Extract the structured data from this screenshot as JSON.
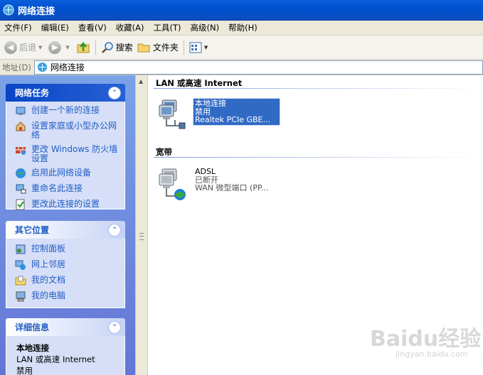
{
  "window": {
    "title": "网络连接"
  },
  "menu": [
    {
      "label": "文件(F)"
    },
    {
      "label": "编辑(E)"
    },
    {
      "label": "查看(V)"
    },
    {
      "label": "收藏(A)"
    },
    {
      "label": "工具(T)"
    },
    {
      "label": "高级(N)"
    },
    {
      "label": "帮助(H)"
    }
  ],
  "toolbar": {
    "back": "后退",
    "search": "搜索",
    "folders": "文件夹"
  },
  "address": {
    "label": "地址(D)",
    "value": "网络连接"
  },
  "tasks": {
    "title": "网络任务",
    "items": [
      {
        "label": "创建一个新的连接"
      },
      {
        "label": "设置家庭或小型办公网络"
      },
      {
        "label": "更改 Windows 防火墙设置"
      },
      {
        "label": "启用此网络设备"
      },
      {
        "label": "重命名此连接"
      },
      {
        "label": "更改此连接的设置"
      }
    ]
  },
  "places": {
    "title": "其它位置",
    "items": [
      {
        "label": "控制面板"
      },
      {
        "label": "网上邻居"
      },
      {
        "label": "我的文档"
      },
      {
        "label": "我的电脑"
      }
    ]
  },
  "details": {
    "title": "详细信息",
    "name": "本地连接",
    "type": "LAN 或高速 Internet",
    "status": "禁用"
  },
  "groups": {
    "lan": {
      "title": "LAN 或高速 Internet",
      "connection": {
        "name": "本地连接",
        "status": "禁用",
        "device": "Realtek PCIe GBE..."
      }
    },
    "broadband": {
      "title": "宽带",
      "connection": {
        "name": "ADSL",
        "status": "已断开",
        "device": "WAN 微型端口 (PP..."
      }
    }
  },
  "watermark": {
    "text": "Baidu经验",
    "sub": "jingyan.baidu.com"
  },
  "colors": {
    "titlebar": "#0050d0",
    "link": "#215dc6",
    "selection": "#316ac5"
  },
  "icons": {
    "window": "network-connections-icon",
    "back": "back-arrow-icon",
    "forward": "forward-arrow-icon",
    "up": "folder-up-icon",
    "search": "search-icon",
    "folders": "folder-icon",
    "views": "views-icon"
  }
}
